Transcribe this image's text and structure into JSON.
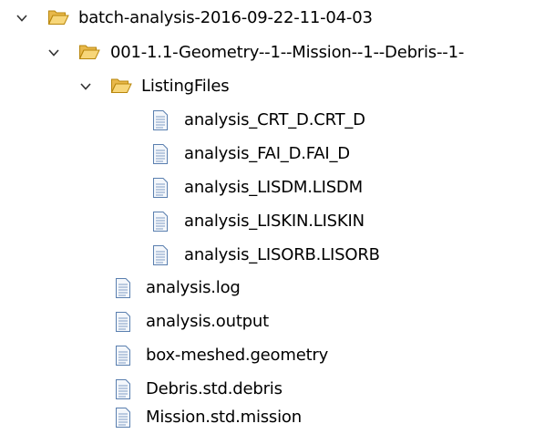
{
  "tree": {
    "root": {
      "label": "batch-analysis-2016-09-22-11-04-03",
      "expanded": true,
      "icon": "folder-open-icon"
    },
    "case": {
      "label": "001-1.1-Geometry--1--Mission--1--Debris--1-",
      "expanded": true,
      "icon": "folder-open-icon"
    },
    "listing": {
      "label": "ListingFiles",
      "expanded": true,
      "icon": "folder-open-icon"
    },
    "listing_files": [
      {
        "label": "analysis_CRT_D.CRT_D",
        "icon": "text-file-icon"
      },
      {
        "label": "analysis_FAI_D.FAI_D",
        "icon": "text-file-icon"
      },
      {
        "label": "analysis_LISDM.LISDM",
        "icon": "text-file-icon"
      },
      {
        "label": "analysis_LISKIN.LISKIN",
        "icon": "text-file-icon"
      },
      {
        "label": "analysis_LISORB.LISORB",
        "icon": "text-file-icon"
      }
    ],
    "case_files": [
      {
        "label": "analysis.log",
        "icon": "text-file-icon"
      },
      {
        "label": "analysis.output",
        "icon": "text-file-icon"
      },
      {
        "label": "box-meshed.geometry",
        "icon": "text-file-icon"
      },
      {
        "label": "Debris.std.debris",
        "icon": "text-file-icon"
      },
      {
        "label": "Mission.std.mission",
        "icon": "text-file-icon"
      }
    ]
  },
  "colors": {
    "chevron": "#333333",
    "folder_back": "#E8B84A",
    "folder_front": "#F7D679",
    "folder_stroke": "#B8860B",
    "file_fill": "#F4F7FB",
    "file_stroke": "#5A7FAF",
    "file_lines": "#7F9CC6"
  }
}
